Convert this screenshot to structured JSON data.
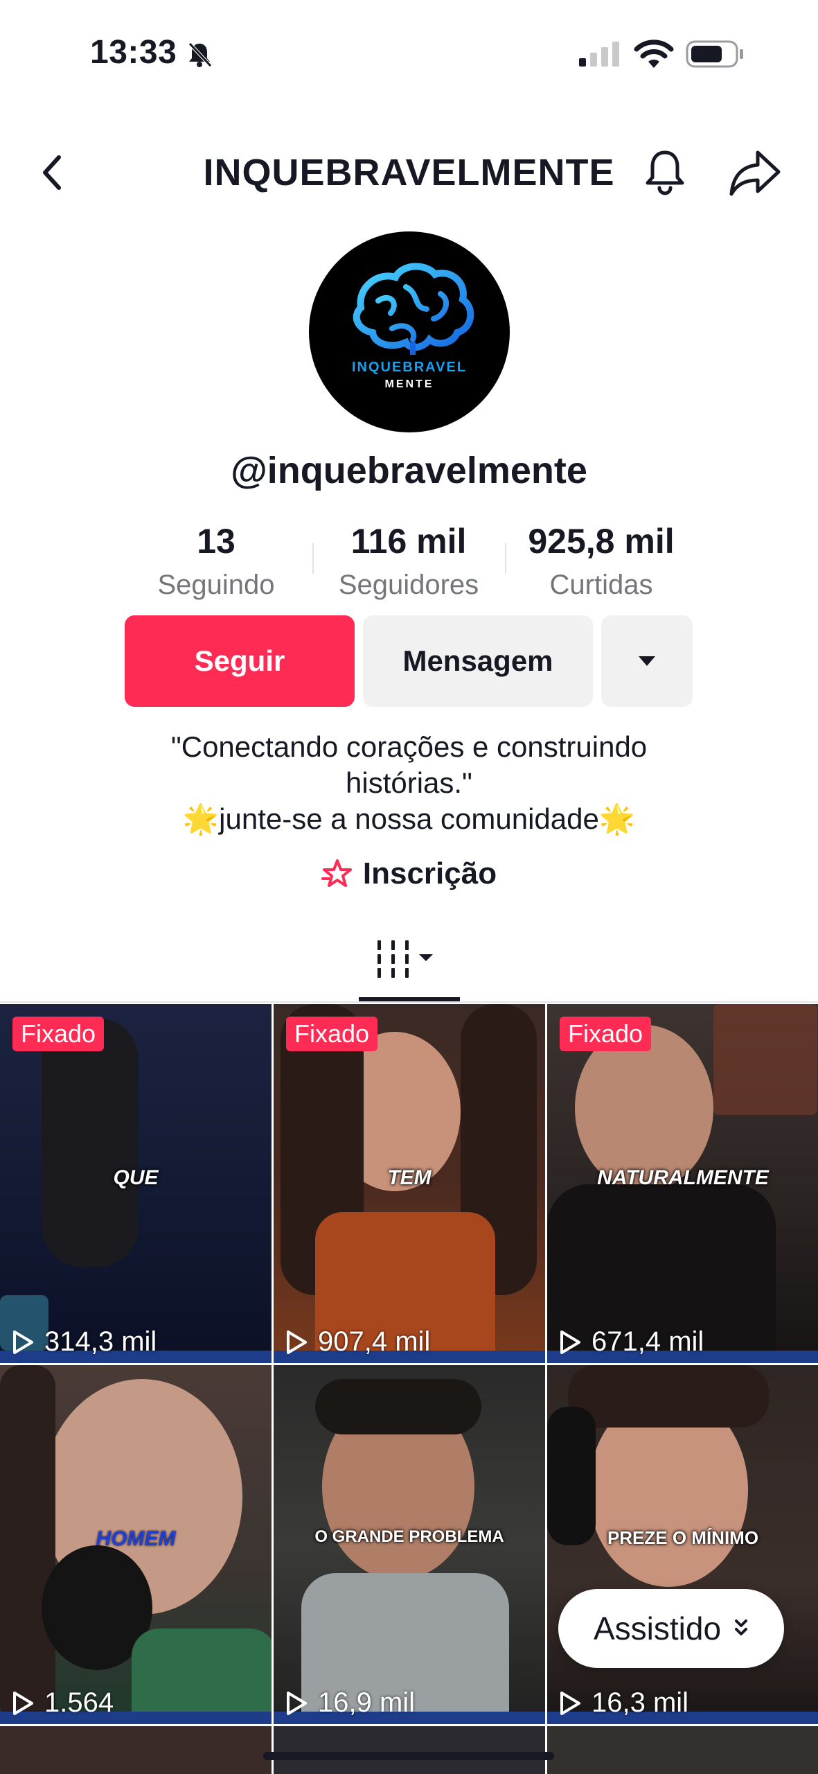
{
  "status_bar": {
    "time": "13:33"
  },
  "header": {
    "title": "INQUEBRAVELMENTE"
  },
  "profile": {
    "avatar_line1": "INQUEBRAVEL",
    "avatar_line2": "MENTE",
    "username": "@inquebravelmente",
    "stats": [
      {
        "value": "13",
        "label": "Seguindo"
      },
      {
        "value": "116 mil",
        "label": "Seguidores"
      },
      {
        "value": "925,8 mil",
        "label": "Curtidas"
      }
    ],
    "buttons": {
      "follow": "Seguir",
      "message": "Mensagem"
    },
    "bio_line1": "\"Conectando corações e construindo",
    "bio_line2": "histórias.\"",
    "bio_line3_star": "🌟",
    "bio_line3_text": "junte-se a nossa comunidade",
    "link_label": "Inscrição"
  },
  "videos": [
    {
      "pinned": "Fixado",
      "caption": "QUE",
      "views": "314,3 mil"
    },
    {
      "pinned": "Fixado",
      "caption": "TEM",
      "views": "907,4 mil"
    },
    {
      "pinned": "Fixado",
      "caption": "NATURALMENTE",
      "views": "671,4 mil"
    },
    {
      "caption": "HOMEM",
      "views": "1.564"
    },
    {
      "caption": "O GRANDE PROBLEMA",
      "views": "16,9 mil"
    },
    {
      "caption": "PREZE O MÍNIMO",
      "views": "16,3 mil"
    }
  ],
  "watched_pill": "Assistido",
  "colors": {
    "accent": "#fe2c55",
    "secondary_button": "#f1f1f2",
    "muted_text": "#75767c"
  }
}
